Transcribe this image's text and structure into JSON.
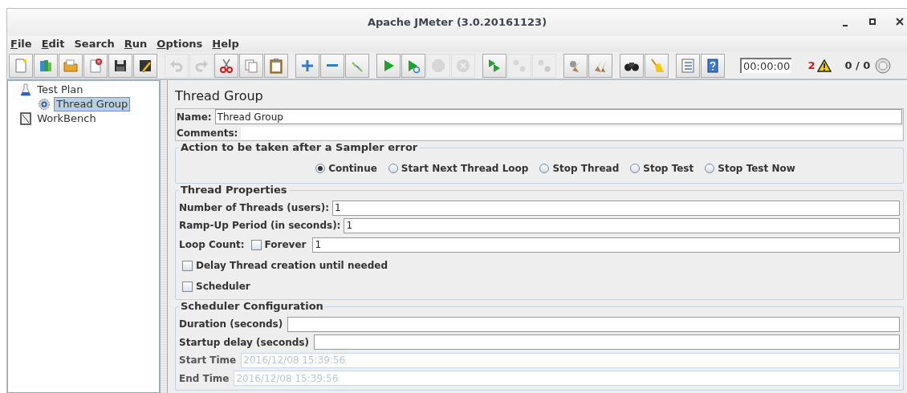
{
  "window": {
    "title": "Apache JMeter (3.0.20161123)"
  },
  "menu": [
    {
      "label": "File",
      "mnemonic_underlined": true
    },
    {
      "label": "Edit",
      "mnemonic_underlined": true
    },
    {
      "label": "Search",
      "mnemonic_underlined": false
    },
    {
      "label": "Run",
      "mnemonic_underlined": true
    },
    {
      "label": "Options",
      "mnemonic_underlined": true
    },
    {
      "label": "Help",
      "mnemonic_underlined": true
    }
  ],
  "toolbar": {
    "groups": [
      [
        {
          "kind": "new",
          "disabled": false
        },
        {
          "kind": "templates",
          "disabled": false
        },
        {
          "kind": "open",
          "disabled": false
        },
        {
          "kind": "close",
          "disabled": false
        },
        {
          "kind": "save",
          "disabled": false
        },
        {
          "kind": "save-as",
          "disabled": false
        }
      ],
      [
        {
          "kind": "undo",
          "disabled": true
        },
        {
          "kind": "redo",
          "disabled": true
        },
        {
          "kind": "cut",
          "disabled": false
        },
        {
          "kind": "copy",
          "disabled": false
        },
        {
          "kind": "paste",
          "disabled": false
        }
      ],
      [
        {
          "kind": "expand",
          "disabled": false
        },
        {
          "kind": "collapse",
          "disabled": false
        },
        {
          "kind": "toggle",
          "disabled": false
        }
      ],
      [
        {
          "kind": "start",
          "disabled": false
        },
        {
          "kind": "start-no-pause",
          "disabled": false
        },
        {
          "kind": "stop",
          "disabled": true
        },
        {
          "kind": "shutdown",
          "disabled": true
        }
      ],
      [
        {
          "kind": "remote-start",
          "disabled": false
        },
        {
          "kind": "remote-stop",
          "disabled": true
        },
        {
          "kind": "remote-exit",
          "disabled": true
        }
      ],
      [
        {
          "kind": "clear",
          "disabled": false
        },
        {
          "kind": "clear-all",
          "disabled": false
        }
      ],
      [
        {
          "kind": "search",
          "disabled": false
        },
        {
          "kind": "reset-search",
          "disabled": false
        }
      ],
      [
        {
          "kind": "function-helper",
          "disabled": false
        },
        {
          "kind": "help",
          "disabled": false
        }
      ]
    ],
    "timer": "00:00:00",
    "error_count": "2",
    "threads": "0 / 0"
  },
  "tree": [
    {
      "label": "Test Plan",
      "kind": "plan",
      "selected": false,
      "children": [
        {
          "label": "Thread Group",
          "kind": "thread-group",
          "selected": true
        }
      ]
    },
    {
      "label": "WorkBench",
      "kind": "workbench",
      "selected": false
    }
  ],
  "panel": {
    "title": "Thread Group",
    "name": {
      "label": "Name:",
      "value": "Thread Group"
    },
    "comments": {
      "label": "Comments:"
    },
    "sampler_error": {
      "title": "Action to be taken after a Sampler error",
      "options": [
        {
          "label": "Continue",
          "selected": true
        },
        {
          "label": "Start Next Thread Loop",
          "selected": false
        },
        {
          "label": "Stop Thread",
          "selected": false
        },
        {
          "label": "Stop Test",
          "selected": false
        },
        {
          "label": "Stop Test Now",
          "selected": false
        }
      ]
    },
    "thread_properties": {
      "title": "Thread Properties",
      "threads": {
        "label": "Number of Threads (users):",
        "value": "1"
      },
      "ramp_up": {
        "label": "Ramp-Up Period (in seconds):",
        "value": "1"
      },
      "loop_count": {
        "label": "Loop Count:",
        "forever": {
          "label": "Forever",
          "checked": false
        },
        "value": "1"
      },
      "delay_creation": {
        "label": "Delay Thread creation until needed",
        "checked": false
      },
      "scheduler": {
        "label": "Scheduler",
        "checked": false
      }
    },
    "scheduler_config": {
      "title": "Scheduler Configuration",
      "fields": [
        {
          "label": "Duration (seconds)",
          "disabled": false
        },
        {
          "label": "Startup delay (seconds)",
          "disabled": false
        },
        {
          "label": "Start Time",
          "value": "2016/12/08 15:39:56",
          "disabled": true
        },
        {
          "label": "End Time",
          "value": "2016/12/08 15:39:56",
          "disabled": true
        }
      ]
    }
  }
}
